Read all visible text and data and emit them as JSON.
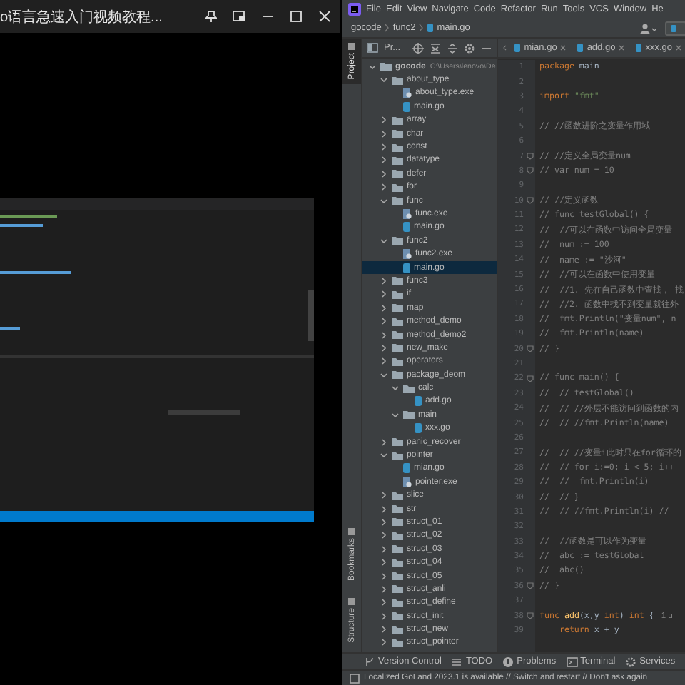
{
  "player": {
    "title": "o语言急速入门视频教程..."
  },
  "ide": {
    "menu": [
      "File",
      "Edit",
      "View",
      "Navigate",
      "Code",
      "Refactor",
      "Run",
      "Tools",
      "VCS",
      "Window",
      "He"
    ],
    "breadcrumb": [
      {
        "label": "gocode",
        "kind": "plain"
      },
      {
        "label": "func2",
        "kind": "plain"
      },
      {
        "label": "main.go",
        "kind": "go"
      }
    ],
    "side_tabs": [
      {
        "label": "Project",
        "selected": true,
        "kind": "top"
      },
      {
        "label": "Bookmarks",
        "selected": false,
        "kind": "bottom"
      },
      {
        "label": "Structure",
        "selected": false,
        "kind": "bottom"
      }
    ],
    "project_panel": {
      "title": "Pr...",
      "tree": [
        {
          "name": "gocode",
          "path": "C:\\Users\\lenovo\\De",
          "kind": "folder",
          "expanded": true,
          "selected": false,
          "children": [
            {
              "name": "about_type",
              "kind": "folder",
              "expanded": true,
              "selected": false,
              "children": [
                {
                  "name": "about_type.exe",
                  "kind": "exe",
                  "selected": false
                },
                {
                  "name": "main.go",
                  "kind": "go",
                  "selected": false
                }
              ]
            },
            {
              "name": "array",
              "kind": "folder",
              "expanded": false,
              "selected": false
            },
            {
              "name": "char",
              "kind": "folder",
              "expanded": false,
              "selected": false
            },
            {
              "name": "const",
              "kind": "folder",
              "expanded": false,
              "selected": false
            },
            {
              "name": "datatype",
              "kind": "folder",
              "expanded": false,
              "selected": false
            },
            {
              "name": "defer",
              "kind": "folder",
              "expanded": false,
              "selected": false
            },
            {
              "name": "for",
              "kind": "folder",
              "expanded": false,
              "selected": false
            },
            {
              "name": "func",
              "kind": "folder",
              "expanded": true,
              "selected": false,
              "children": [
                {
                  "name": "func.exe",
                  "kind": "exe",
                  "selected": false
                },
                {
                  "name": "main.go",
                  "kind": "go",
                  "selected": false
                }
              ]
            },
            {
              "name": "func2",
              "kind": "folder",
              "expanded": true,
              "selected": false,
              "children": [
                {
                  "name": "func2.exe",
                  "kind": "exe",
                  "selected": false
                },
                {
                  "name": "main.go",
                  "kind": "go",
                  "selected": true
                }
              ]
            },
            {
              "name": "func3",
              "kind": "folder",
              "expanded": false,
              "selected": false
            },
            {
              "name": "if",
              "kind": "folder",
              "expanded": false,
              "selected": false
            },
            {
              "name": "map",
              "kind": "folder",
              "expanded": false,
              "selected": false
            },
            {
              "name": "method_demo",
              "kind": "folder",
              "expanded": false,
              "selected": false
            },
            {
              "name": "method_demo2",
              "kind": "folder",
              "expanded": false,
              "selected": false
            },
            {
              "name": "new_make",
              "kind": "folder",
              "expanded": false,
              "selected": false
            },
            {
              "name": "operators",
              "kind": "folder",
              "expanded": false,
              "selected": false
            },
            {
              "name": "package_deom",
              "kind": "folder",
              "expanded": true,
              "selected": false,
              "children": [
                {
                  "name": "calc",
                  "kind": "folder",
                  "expanded": true,
                  "selected": false,
                  "children": [
                    {
                      "name": "add.go",
                      "kind": "go",
                      "selected": false
                    }
                  ]
                },
                {
                  "name": "main",
                  "kind": "folder",
                  "expanded": true,
                  "selected": false,
                  "children": [
                    {
                      "name": "xxx.go",
                      "kind": "go",
                      "selected": false
                    }
                  ]
                }
              ]
            },
            {
              "name": "panic_recover",
              "kind": "folder",
              "expanded": false,
              "selected": false
            },
            {
              "name": "pointer",
              "kind": "folder",
              "expanded": true,
              "selected": false,
              "children": [
                {
                  "name": "mian.go",
                  "kind": "go",
                  "selected": false
                },
                {
                  "name": "pointer.exe",
                  "kind": "exe",
                  "selected": false
                }
              ]
            },
            {
              "name": "slice",
              "kind": "folder",
              "expanded": false,
              "selected": false
            },
            {
              "name": "str",
              "kind": "folder",
              "expanded": false,
              "selected": false
            },
            {
              "name": "struct_01",
              "kind": "folder",
              "expanded": false,
              "selected": false
            },
            {
              "name": "struct_02",
              "kind": "folder",
              "expanded": false,
              "selected": false
            },
            {
              "name": "struct_03",
              "kind": "folder",
              "expanded": false,
              "selected": false
            },
            {
              "name": "struct_04",
              "kind": "folder",
              "expanded": false,
              "selected": false
            },
            {
              "name": "struct_05",
              "kind": "folder",
              "expanded": false,
              "selected": false
            },
            {
              "name": "struct_anli",
              "kind": "folder",
              "expanded": false,
              "selected": false
            },
            {
              "name": "struct_define",
              "kind": "folder",
              "expanded": false,
              "selected": false
            },
            {
              "name": "struct_init",
              "kind": "folder",
              "expanded": false,
              "selected": false
            },
            {
              "name": "struct_new",
              "kind": "folder",
              "expanded": false,
              "selected": false
            },
            {
              "name": "struct_pointer",
              "kind": "folder",
              "expanded": false,
              "selected": false
            }
          ]
        }
      ]
    },
    "editor_tabs": [
      {
        "label": "mian.go",
        "selected": false
      },
      {
        "label": "add.go",
        "selected": false
      },
      {
        "label": "xxx.go",
        "selected": false
      }
    ],
    "lines": [
      {
        "number": "1",
        "fold": false,
        "segments": [
          {
            "kind": "kw",
            "text": "package"
          },
          {
            "kind": "plain",
            "text": " main"
          }
        ]
      },
      {
        "number": "2",
        "fold": false
      },
      {
        "number": "3",
        "fold": false,
        "segments": [
          {
            "kind": "kw",
            "text": "import"
          },
          {
            "kind": "str",
            "text": " \"fmt\""
          }
        ]
      },
      {
        "number": "4",
        "fold": false
      },
      {
        "number": "5",
        "fold": false,
        "segments": [
          {
            "kind": "comment",
            "text": "// //函数进阶之变量作用域"
          }
        ]
      },
      {
        "number": "6",
        "fold": false
      },
      {
        "number": "7",
        "fold": true,
        "segments": [
          {
            "kind": "comment",
            "text": "// //定义全局变量num"
          }
        ]
      },
      {
        "number": "8",
        "fold": true,
        "segments": [
          {
            "kind": "comment",
            "text": "// var num = 10"
          }
        ]
      },
      {
        "number": "9",
        "fold": false
      },
      {
        "number": "10",
        "fold": true,
        "segments": [
          {
            "kind": "comment",
            "text": "// //定义函数"
          }
        ]
      },
      {
        "number": "11",
        "fold": false,
        "segments": [
          {
            "kind": "comment",
            "text": "// func testGlobal() {"
          }
        ]
      },
      {
        "number": "12",
        "fold": false,
        "segments": [
          {
            "kind": "comment",
            "text": "//  //可以在函数中访问全局变量"
          }
        ]
      },
      {
        "number": "13",
        "fold": false,
        "segments": [
          {
            "kind": "comment",
            "text": "//  num := 100"
          }
        ]
      },
      {
        "number": "14",
        "fold": false,
        "segments": [
          {
            "kind": "comment",
            "text": "//  name := \"沙河\""
          }
        ]
      },
      {
        "number": "15",
        "fold": false,
        "segments": [
          {
            "kind": "comment",
            "text": "//  //可以在函数中使用变量"
          }
        ]
      },
      {
        "number": "16",
        "fold": false,
        "segments": [
          {
            "kind": "comment",
            "text": "//  //1. 先在自己函数中查找， 找"
          }
        ]
      },
      {
        "number": "17",
        "fold": false,
        "segments": [
          {
            "kind": "comment",
            "text": "//  //2. 函数中找不到变量就往外"
          }
        ]
      },
      {
        "number": "18",
        "fold": false,
        "segments": [
          {
            "kind": "comment",
            "text": "//  fmt.Println(\"变量num\", n"
          }
        ]
      },
      {
        "number": "19",
        "fold": false,
        "segments": [
          {
            "kind": "comment",
            "text": "//  fmt.Println(name)"
          }
        ]
      },
      {
        "number": "20",
        "fold": true,
        "segments": [
          {
            "kind": "comment",
            "text": "// }"
          }
        ]
      },
      {
        "number": "21",
        "fold": false
      },
      {
        "number": "22",
        "fold": true,
        "segments": [
          {
            "kind": "comment",
            "text": "// func main() {"
          }
        ]
      },
      {
        "number": "23",
        "fold": false,
        "segments": [
          {
            "kind": "comment",
            "text": "//  // testGlobal()"
          }
        ]
      },
      {
        "number": "24",
        "fold": false,
        "segments": [
          {
            "kind": "comment",
            "text": "//  // //外层不能访问到函数的内"
          }
        ]
      },
      {
        "number": "25",
        "fold": false,
        "segments": [
          {
            "kind": "comment",
            "text": "//  // //fmt.Println(name)"
          }
        ]
      },
      {
        "number": "26",
        "fold": false
      },
      {
        "number": "27",
        "fold": false,
        "segments": [
          {
            "kind": "comment",
            "text": "//  // //变量i此时只在for循环的"
          }
        ]
      },
      {
        "number": "28",
        "fold": false,
        "segments": [
          {
            "kind": "comment",
            "text": "//  // for i:=0; i < 5; i++"
          }
        ]
      },
      {
        "number": "29",
        "fold": false,
        "segments": [
          {
            "kind": "comment",
            "text": "//  //  fmt.Println(i)"
          }
        ]
      },
      {
        "number": "30",
        "fold": false,
        "segments": [
          {
            "kind": "comment",
            "text": "//  // }"
          }
        ]
      },
      {
        "number": "31",
        "fold": false,
        "segments": [
          {
            "kind": "comment",
            "text": "//  // //fmt.Println(i) //"
          }
        ]
      },
      {
        "number": "32",
        "fold": false
      },
      {
        "number": "33",
        "fold": false,
        "segments": [
          {
            "kind": "comment",
            "text": "//  //函数是可以作为变量"
          }
        ]
      },
      {
        "number": "34",
        "fold": false,
        "segments": [
          {
            "kind": "comment",
            "text": "//  abc := testGlobal"
          }
        ]
      },
      {
        "number": "35",
        "fold": false,
        "segments": [
          {
            "kind": "comment",
            "text": "//  abc()"
          }
        ]
      },
      {
        "number": "36",
        "fold": true,
        "segments": [
          {
            "kind": "comment",
            "text": "// }"
          }
        ]
      },
      {
        "number": "37",
        "fold": false
      },
      {
        "number": "38",
        "fold": true,
        "segments": [
          {
            "kind": "kw",
            "text": "func"
          },
          {
            "kind": "fn",
            "text": " add"
          },
          {
            "kind": "plain",
            "text": "(x,y "
          },
          {
            "kind": "kw",
            "text": "int"
          },
          {
            "kind": "plain",
            "text": ") "
          },
          {
            "kind": "kw",
            "text": "int"
          },
          {
            "kind": "plain",
            "text": " {"
          },
          {
            "kind": "hint",
            "text": "1 u"
          }
        ]
      },
      {
        "number": "39",
        "fold": false,
        "segments": [
          {
            "kind": "kw",
            "text": "    return"
          },
          {
            "kind": "plain",
            "text": " x + y"
          }
        ]
      }
    ],
    "tool_tabs": [
      {
        "label": "Version Control",
        "kind": "vcs"
      },
      {
        "label": "TODO",
        "kind": "todo"
      },
      {
        "label": "Problems",
        "kind": "problems"
      },
      {
        "label": "Terminal",
        "kind": "terminal"
      },
      {
        "label": "Services",
        "kind": "services"
      }
    ],
    "status": "Localized GoLand 2023.1 is available // Switch and restart // Don't ask again"
  }
}
